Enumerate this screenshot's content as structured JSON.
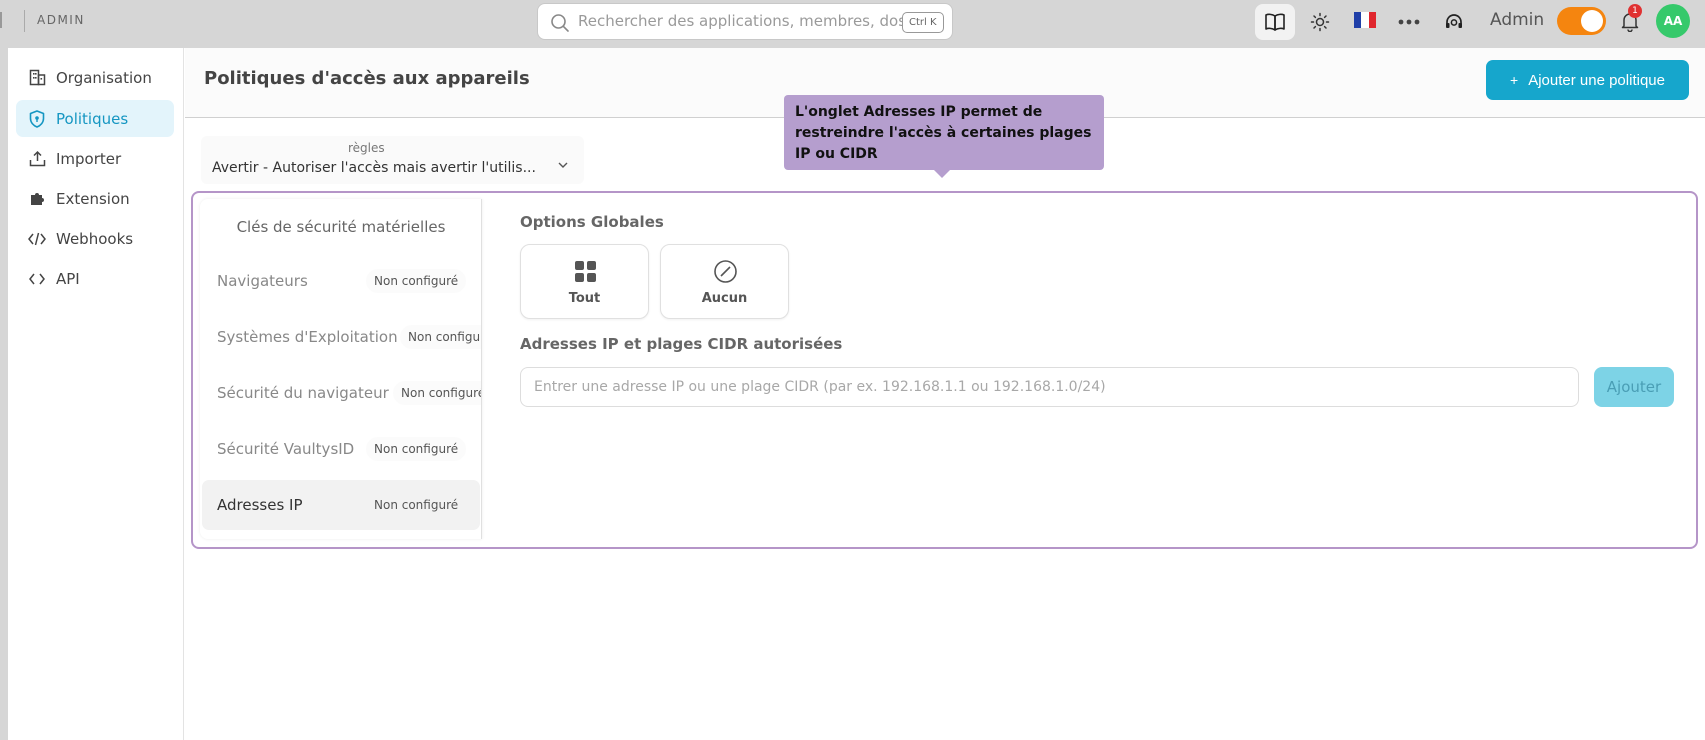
{
  "topbar": {
    "brand": "ADMIN",
    "search_placeholder": "Rechercher des applications, membres, dossiers...",
    "shortcut": "Ctrl K",
    "admin_label": "Admin",
    "notification_count": "1",
    "avatar_initials": "AA",
    "accent": "#f5850f"
  },
  "sidebar": {
    "items": [
      {
        "label": "Organisation",
        "icon": "building-icon"
      },
      {
        "label": "Politiques",
        "icon": "shield-icon"
      },
      {
        "label": "Importer",
        "icon": "upload-icon"
      },
      {
        "label": "Extension",
        "icon": "puzzle-icon"
      },
      {
        "label": "Webhooks",
        "icon": "code-slash-icon"
      },
      {
        "label": "API",
        "icon": "code-icon"
      }
    ],
    "active_index": 1
  },
  "header": {
    "title": "Politiques d'accès aux appareils",
    "add_button": "Ajouter une politique"
  },
  "tooltip": {
    "text": "L'onglet Adresses IP permet de restreindre l'accès à certaines plages IP ou CIDR"
  },
  "select": {
    "label": "règles",
    "value": "Avertir - Autoriser l'accès mais avertir l'utilisateur"
  },
  "tabs": {
    "hardware": "Clés de sécurité matérielles",
    "items": [
      {
        "label": "Navigateurs",
        "status": "Non configuré"
      },
      {
        "label": "Systèmes d'Exploitation",
        "status": "Non configuré"
      },
      {
        "label": "Sécurité du navigateur",
        "status": "Non configuré"
      },
      {
        "label": "Sécurité VaultysID",
        "status": "Non configuré"
      },
      {
        "label": "Adresses IP",
        "status": "Non configuré"
      }
    ],
    "active": "Adresses IP"
  },
  "content": {
    "global_options_title": "Options Globales",
    "option_all": "Tout",
    "option_none": "Aucun",
    "ip_title": "Adresses IP et plages CIDR autorisées",
    "ip_placeholder": "Entrer une adresse IP ou une plage CIDR (par ex. 192.168.1.1 ou 192.168.1.0/24)",
    "add_label": "Ajouter"
  }
}
